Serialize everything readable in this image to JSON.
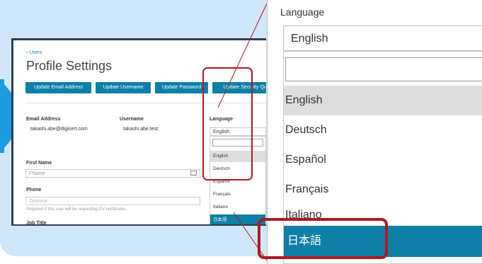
{
  "app": {
    "back_link": "‹ Users",
    "page_title": "Profile Settings",
    "buttons": {
      "update_email": "Update Email Address",
      "update_username": "Update Username",
      "update_password": "Update Password",
      "update_security": "Update Security Ques"
    },
    "fields": {
      "email_label": "Email Address",
      "email_value": "takashi.abe@digicert.com",
      "username_label": "Username",
      "username_value": "takashi.abe.test",
      "language_label": "Language",
      "language_value": "English",
      "first_name_label": "First Name",
      "first_name_placeholder": "FName",
      "phone_label": "Phone",
      "phone_placeholder": "Optional",
      "phone_hint": "Required if this user will be requesting EV certificates.",
      "job_title_label": "Job Title"
    },
    "language_options": [
      "English",
      "Deutsch",
      "Español",
      "Français",
      "Italiano",
      "日本語"
    ]
  },
  "zoom": {
    "label": "Language",
    "selected": "English",
    "options": [
      "English",
      "Deutsch",
      "Español",
      "Français",
      "Italiano",
      "日本語"
    ]
  },
  "colors": {
    "accent": "#0e7fa6",
    "highlight_ring": "#b01920",
    "background": "#cfe7f8",
    "arrow": "#1e9ae0"
  }
}
